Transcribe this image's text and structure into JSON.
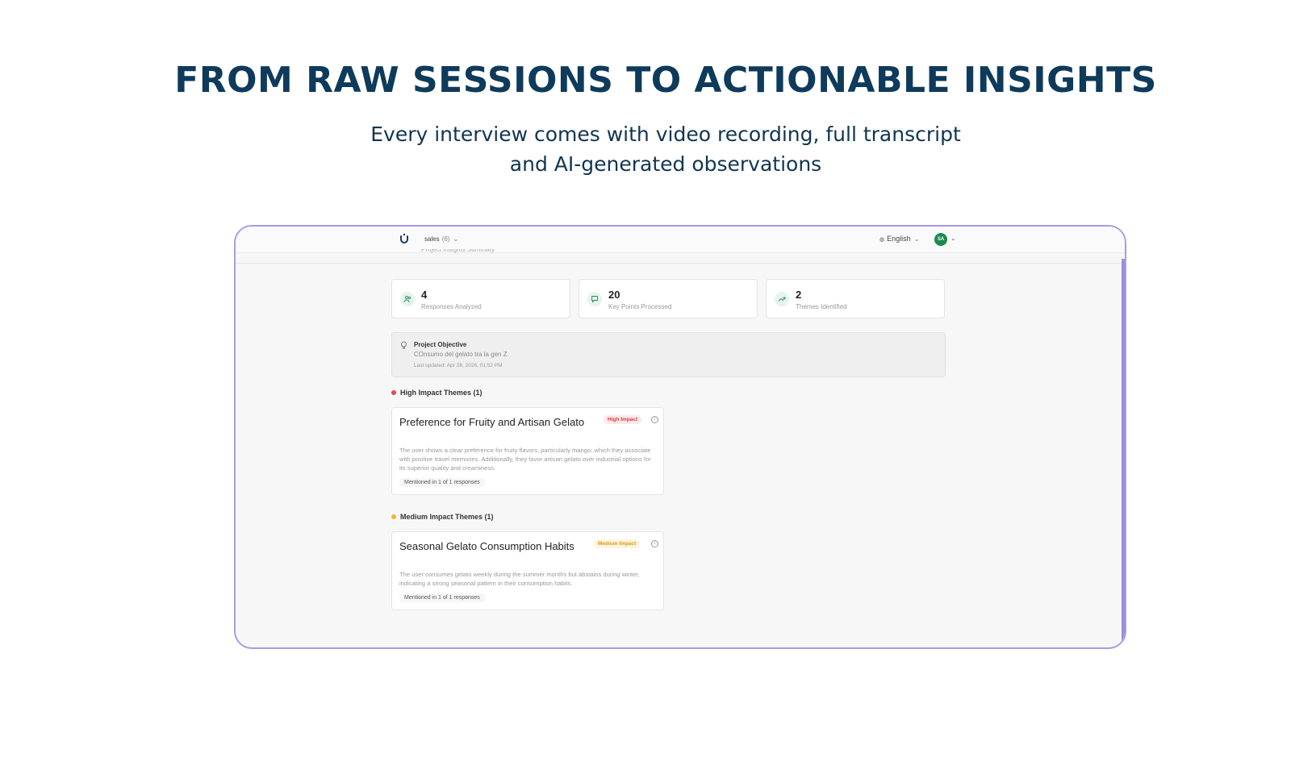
{
  "hero": {
    "title": "FROM RAW SESSIONS TO ACTIONABLE INSIGHTS",
    "subtitle_line1": "Every interview comes with video recording, full transcript",
    "subtitle_line2": "and AI-generated observations"
  },
  "topbar": {
    "workspace": "sales",
    "workspace_count": "(6)",
    "language": "English",
    "avatar_initials": "SA",
    "cut_text": "Project Insights Summary"
  },
  "stats": [
    {
      "value": "4",
      "label": "Responses Analyzed",
      "icon": "users-icon"
    },
    {
      "value": "20",
      "label": "Key Points Processed",
      "icon": "message-icon"
    },
    {
      "value": "2",
      "label": "Themes Identified",
      "icon": "trending-up-icon"
    }
  ],
  "objective": {
    "title": "Project Objective",
    "text": "COnsumo del gelato tra la gen Z",
    "updated": "Last updated: Apr 28, 2026, 01:52 PM"
  },
  "sections": {
    "high": {
      "heading": "High Impact Themes (1)",
      "color": "#e5484d",
      "theme_title": "Preference for Fruity and Artisan Gelato",
      "badge": "High Impact",
      "description": "The user shows a clear preference for fruity flavors, particularly mango, which they associate with positive travel memories. Additionally, they favor artisan gelato over industrial options for its superior quality and creaminess.",
      "mention": "Mentioned in 1 of 1 responses"
    },
    "medium": {
      "heading": "Medium Impact Themes (1)",
      "color": "#f0b429",
      "theme_title": "Seasonal Gelato Consumption Habits",
      "badge": "Medium Impact",
      "description": "The user consumes gelato weekly during the summer months but abstains during winter, indicating a strong seasonal pattern in their consumption habits.",
      "mention": "Mentioned in 1 of 1 responses"
    }
  }
}
